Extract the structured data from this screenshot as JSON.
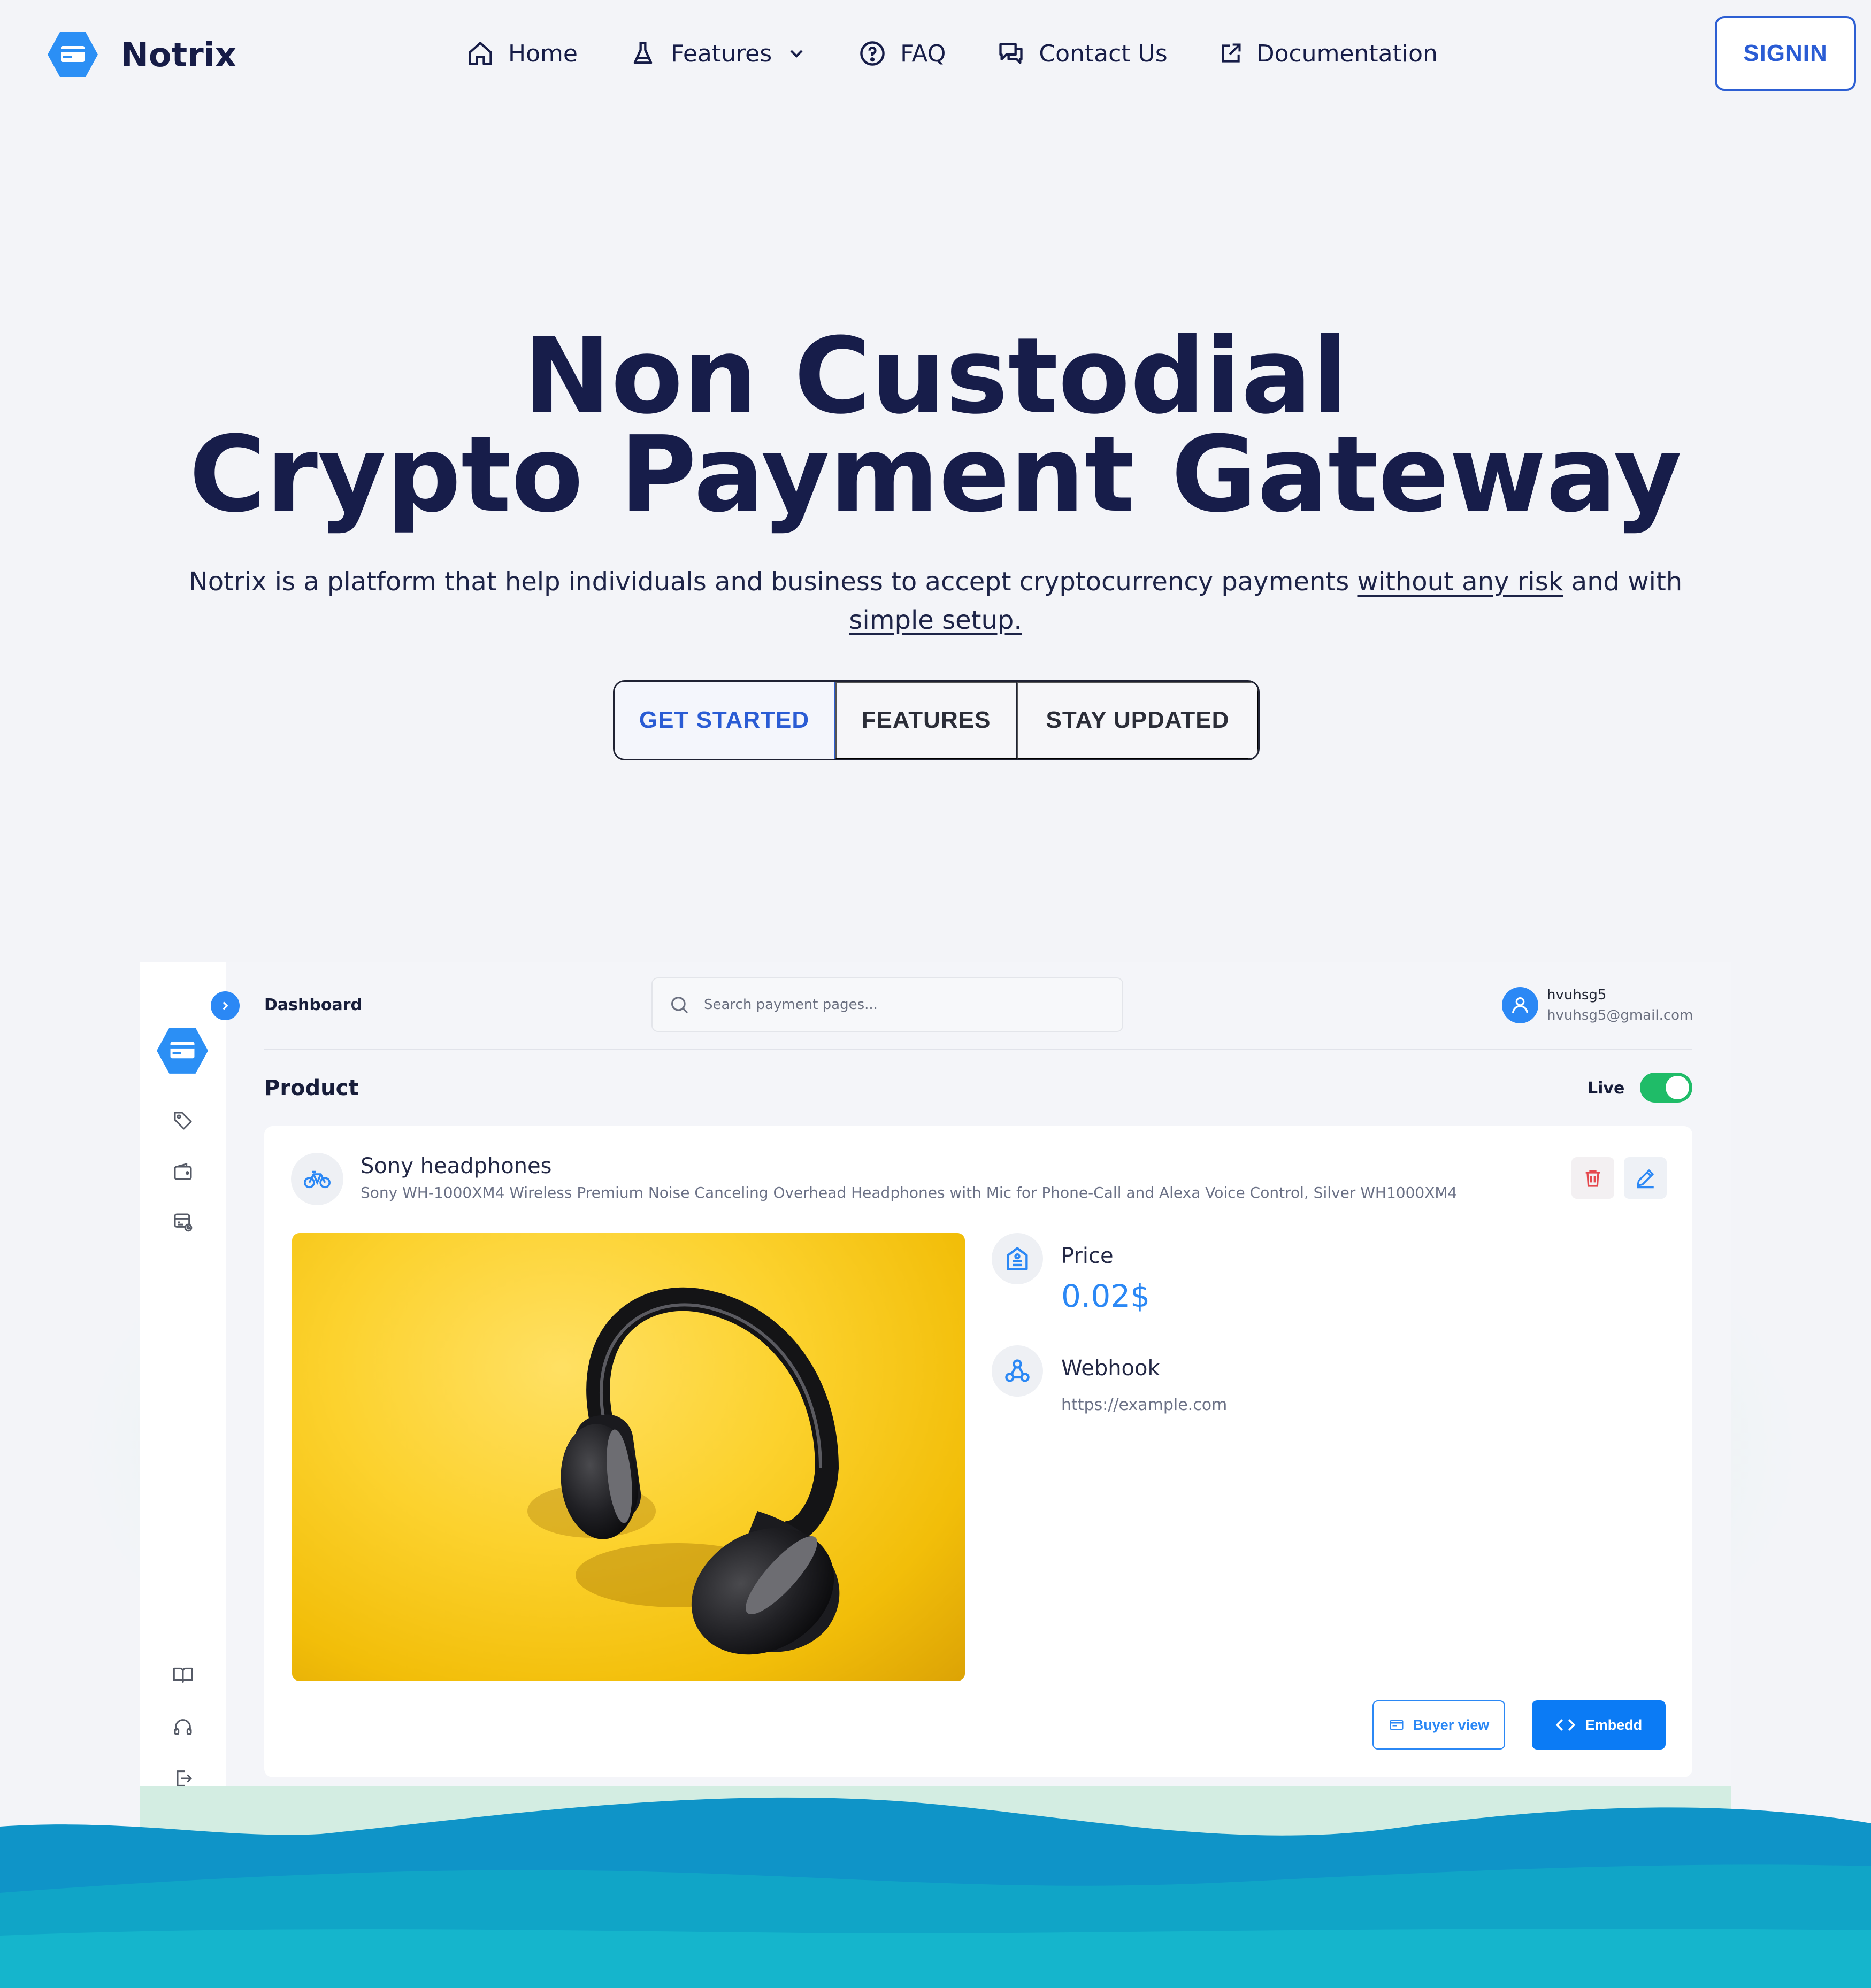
{
  "header": {
    "brand_name": "Notrix",
    "nav": {
      "home": "Home",
      "features": "Features",
      "faq": "FAQ",
      "contact": "Contact Us",
      "docs": "Documentation"
    },
    "signin_label": "SIGNIN"
  },
  "hero": {
    "title_line1": "Non Custodial",
    "title_line2": "Crypto Payment Gateway",
    "subtitle_part1": "Notrix is a platform that help individuals and business to accept cryptocurrency payments ",
    "subtitle_link1": "without any risk",
    "subtitle_part2": " and with ",
    "subtitle_link2": "simple setup.",
    "buttons": {
      "get_started": "GET STARTED",
      "features": "FEATURES",
      "stay_updated": "STAY UPDATED"
    }
  },
  "dashboard": {
    "title": "Dashboard",
    "search_placeholder": "Search payment pages...",
    "user": {
      "name": "hvuhsg5",
      "email": "hvuhsg5@gmail.com"
    },
    "section_title": "Product",
    "live_label": "Live",
    "live_enabled": true,
    "product": {
      "name": "Sony headphones",
      "description": "Sony WH-1000XM4 Wireless Premium Noise Canceling Overhead Headphones with Mic for Phone-Call and Alexa Voice Control, Silver WH1000XM4",
      "price_label": "Price",
      "price_value": "0.02$",
      "webhook_label": "Webhook",
      "webhook_url": "https://example.com"
    },
    "buttons": {
      "buyer_view": "Buyer view",
      "embed": "Embedd"
    }
  },
  "colors": {
    "primary_blue": "#2b88f5",
    "brand_navy": "#171d4a",
    "toggle_green": "#1fbc68",
    "delete_red": "#e5484d",
    "product_bg_yellow": "#fcd22e"
  }
}
